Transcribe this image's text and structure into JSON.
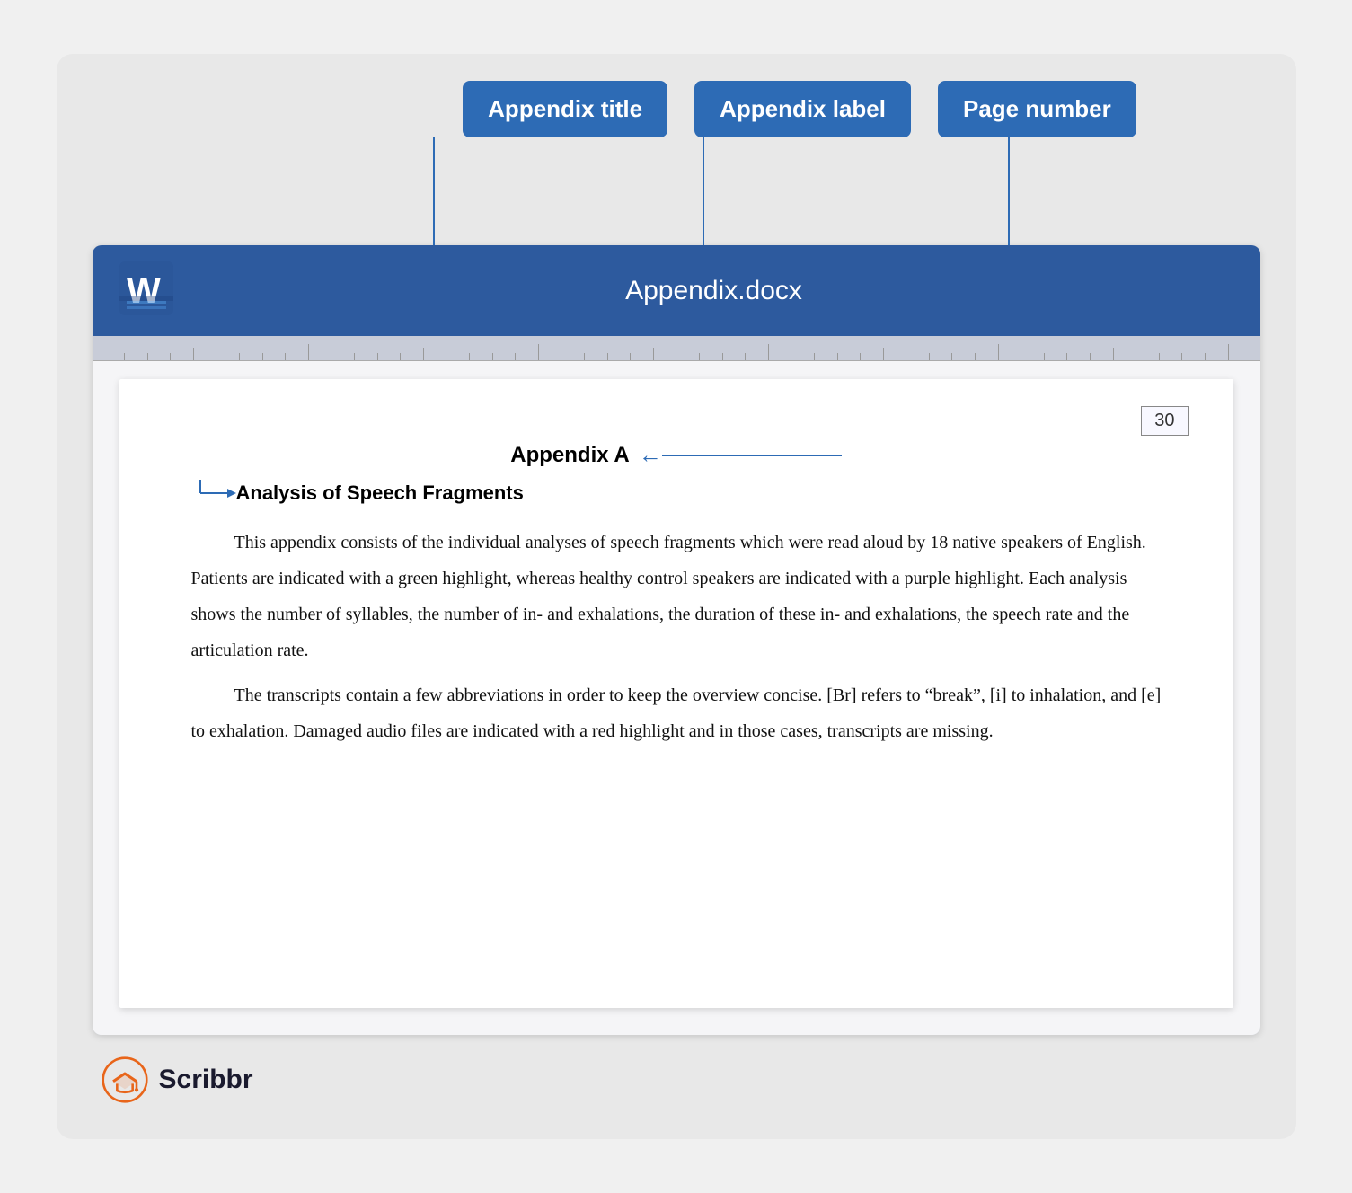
{
  "tooltips": {
    "appendix_title": "Appendix title",
    "appendix_label": "Appendix label",
    "page_number": "Page number"
  },
  "word": {
    "title": "Appendix.docx",
    "page_number": "30",
    "appendix_heading": "Appendix A",
    "appendix_subheading": "Analysis of Speech Fragments",
    "paragraph1": "This appendix consists of the individual analyses of speech fragments which were read aloud by 18 native speakers of English. Patients are indicated with a green highlight, whereas healthy control speakers are indicated with a purple highlight. Each analysis shows the number of syllables, the number of in- and exhalations, the duration of these in- and exhalations, the speech rate and the articulation rate.",
    "paragraph2": "The transcripts contain a few abbreviations in order to keep the overview concise. [Br] refers to “break”, [i] to inhalation, and [e] to exhalation. Damaged audio files are indicated with a red highlight and in those cases, transcripts are missing."
  },
  "scribbr": {
    "brand_name": "Scribbr"
  },
  "colors": {
    "blue": "#2d6bb5",
    "word_bar": "#2d5a9e",
    "orange": "#e8651a"
  }
}
